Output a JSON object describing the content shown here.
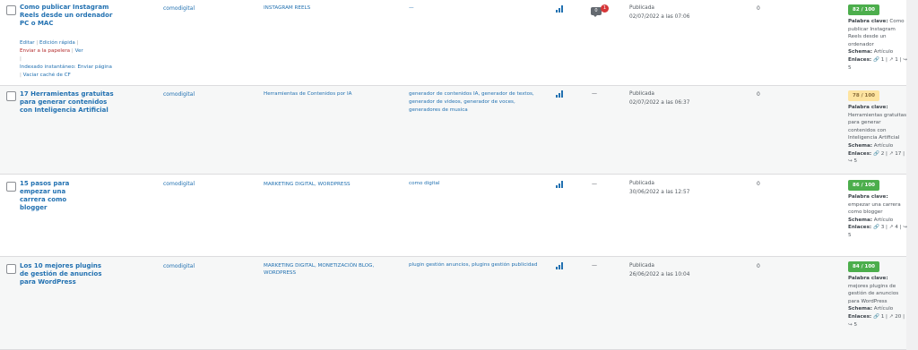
{
  "posts": [
    {
      "title": "Como publicar Instagram Reels desde un ordenador PC o MAC",
      "actions": {
        "edit": "Editar",
        "quick_edit": "Edición rápida",
        "trash": "Enviar a la papelera",
        "view": "Ver",
        "instant_index": "Indexado instantáneo: Enviar página",
        "purge_cache": "Vaciar caché de CF"
      },
      "author": "comodigital",
      "categories": "INSTAGRAM REELS",
      "tags": "—",
      "comments": "0",
      "pending": "1",
      "status": "Publicada",
      "date": "02/07/2022 a las 07:06",
      "count": "0",
      "score": "82 / 100",
      "keyword_label": "Palabra clave:",
      "keyword": "Como publicar Instagram Reels desde un ordenador",
      "schema_label": "Schema:",
      "schema": "Artículo",
      "links_label": "Enlaces:",
      "internal": "1",
      "external": "1",
      "incoming": "5"
    },
    {
      "title": "17 Herramientas gratuitas para generar contenidos con Inteligencia Artificial",
      "author": "comodigital",
      "categories": "Herramientas de Contenidos por IA",
      "tags": "generador de contenidos IA, generador de textos, generador de videos, generador de voces, generadores de musica",
      "comments": "—",
      "status": "Publicada",
      "date": "02/07/2022 a las 06:37",
      "count": "0",
      "score": "78 / 100",
      "keyword_label": "Palabra clave:",
      "keyword": "Herramientas gratuitas para generar contenidos con Inteligencia Artificial",
      "schema_label": "Schema:",
      "schema": "Artículo",
      "links_label": "Enlaces:",
      "internal": "2",
      "external": "17",
      "incoming": "5"
    },
    {
      "title": "15 pasos para empezar una carrera como blogger",
      "author": "comodigital",
      "categories": "MARKETING DIGITAL, WORDPRESS",
      "tags": "como digital",
      "comments": "—",
      "status": "Publicada",
      "date": "30/06/2022 a las 12:57",
      "count": "0",
      "score": "86 / 100",
      "keyword_label": "Palabra clave:",
      "keyword": "empezar una carrera como blogger",
      "schema_label": "Schema:",
      "schema": "Artículo",
      "links_label": "Enlaces:",
      "internal": "3",
      "external": "4",
      "incoming": "5"
    },
    {
      "title": "Los 10 mejores plugins de gestión de anuncios para WordPress",
      "author": "comodigital",
      "categories": "MARKETING DIGITAL, MONETIZACIÓN BLOG, WORDPRESS",
      "tags": "plugin gestión anuncios, plugins gestión publicidad",
      "comments": "—",
      "status": "Publicada",
      "date": "26/06/2022 a las 10:04",
      "count": "0",
      "score": "84 / 100",
      "keyword_label": "Palabra clave:",
      "keyword": "mejores plugins de gestión de anuncios para WordPress",
      "schema_label": "Schema:",
      "schema": "Artículo",
      "links_label": "Enlaces:",
      "internal": "1",
      "external": "20",
      "incoming": "5"
    }
  ],
  "icons": {
    "stats": "bar-chart-icon",
    "link_internal": "link-icon",
    "link_external": "external-link-icon",
    "incoming": "incoming-links-icon"
  },
  "colors": {
    "score_good": "#4cae4c",
    "score_ok": "#fee4a0",
    "link": "#2271b1",
    "trash": "#b32d2e",
    "bubble": "#d63638"
  }
}
